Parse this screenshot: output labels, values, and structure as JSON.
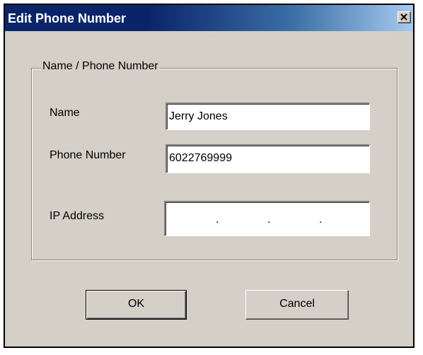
{
  "dialog": {
    "title": "Edit Phone Number"
  },
  "group": {
    "legend": "Name / Phone Number"
  },
  "fields": {
    "name": {
      "label": "Name",
      "value": "Jerry Jones"
    },
    "phone": {
      "label": "Phone Number",
      "value": "6022769999"
    },
    "ip": {
      "label": "IP Address",
      "octets": [
        "",
        "",
        "",
        ""
      ],
      "separator": "."
    }
  },
  "buttons": {
    "ok": "OK",
    "cancel": "Cancel"
  },
  "icons": {
    "close": "close-icon"
  },
  "colors": {
    "titlebar_start": "#0a246a",
    "titlebar_end": "#a6caf0",
    "face": "#d4d0c8"
  }
}
